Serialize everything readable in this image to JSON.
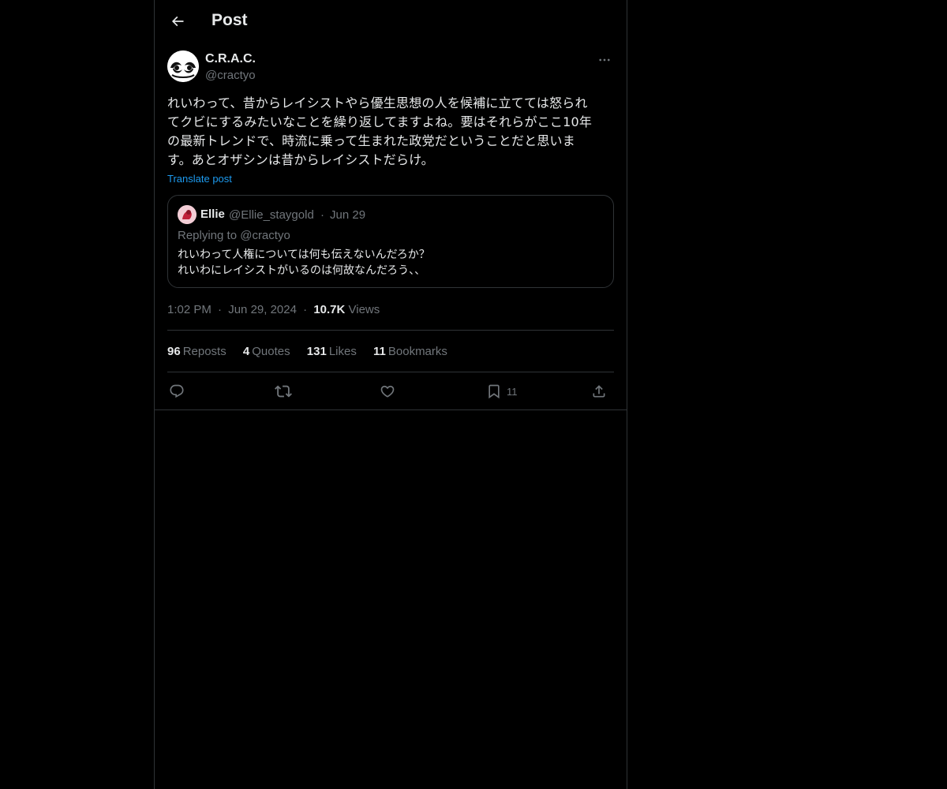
{
  "header": {
    "title": "Post",
    "back_icon": "arrow-left-icon"
  },
  "post": {
    "author": {
      "name": "C.R.A.C.",
      "handle": "@cractyo"
    },
    "text": "れいわって、昔からレイシストやら優生思想の人を候補に立てては怒られ\nてクビにするみたいなことを繰り返してますよね。要はそれらがここ10年\nの最新トレンドで、時流に乗って生まれた政党だということだと思いま\nす。あとオザシンは昔からレイシストだらけ。",
    "translate_label": "Translate post",
    "quote": {
      "name": "Ellie",
      "handle": "@Ellie_staygold",
      "separator": "·",
      "date": "Jun 29",
      "replying_to": "Replying to @cractyo",
      "text": "れいわって人権については何も伝えないんだろか？\nれいわにレイシストがいるのは何故なんだろう、、"
    },
    "meta": {
      "time": "1:02 PM",
      "separator": "·",
      "date": "Jun 29, 2024",
      "views_count": "10.7K",
      "views_label": "Views"
    },
    "stats": {
      "reposts_count": "96",
      "reposts_label": "Reposts",
      "quotes_count": "4",
      "quotes_label": "Quotes",
      "likes_count": "131",
      "likes_label": "Likes",
      "bookmarks_count": "11",
      "bookmarks_label": "Bookmarks"
    },
    "actions": {
      "reply_icon": "reply-icon",
      "repost_icon": "repost-icon",
      "like_icon": "heart-icon",
      "bookmark_icon": "bookmark-icon",
      "bookmark_count": "11",
      "share_icon": "share-icon"
    }
  },
  "colors": {
    "background": "#000000",
    "text_primary": "#e7e9ea",
    "text_secondary": "#71767b",
    "link": "#1d9bf0",
    "border": "#2f3336"
  }
}
